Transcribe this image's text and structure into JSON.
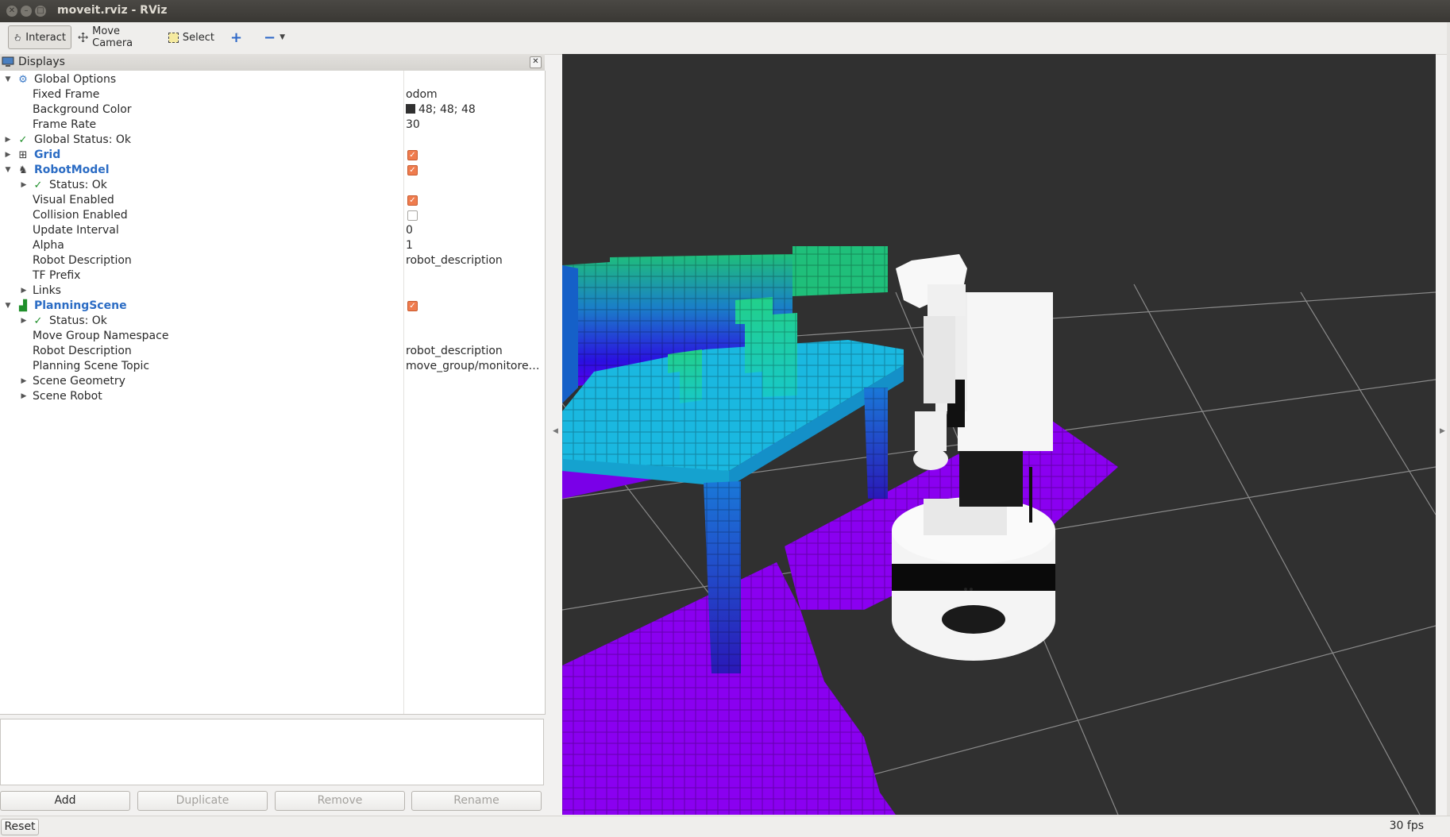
{
  "window": {
    "title": "moveit.rviz - RViz"
  },
  "toolbar": {
    "interact": "Interact",
    "move_camera": "Move Camera",
    "select": "Select",
    "add_tool_icon": "plus-icon",
    "remove_tool_icon": "minus-icon"
  },
  "displays_panel": {
    "title": "Displays",
    "rows": [
      {
        "label": "Global Options"
      },
      {
        "label": "Fixed Frame",
        "value": "odom"
      },
      {
        "label": "Background Color",
        "value": "48; 48; 48",
        "swatch": "#303030"
      },
      {
        "label": "Frame Rate",
        "value": "30"
      },
      {
        "label": "Global Status: Ok"
      },
      {
        "label": "Grid",
        "checked": true
      },
      {
        "label": "RobotModel",
        "checked": true
      },
      {
        "label": "Status: Ok"
      },
      {
        "label": "Visual Enabled",
        "checked": true
      },
      {
        "label": "Collision Enabled",
        "checked": false
      },
      {
        "label": "Update Interval",
        "value": "0"
      },
      {
        "label": "Alpha",
        "value": "1"
      },
      {
        "label": "Robot Description",
        "value": "robot_description"
      },
      {
        "label": "TF Prefix"
      },
      {
        "label": "Links"
      },
      {
        "label": "PlanningScene",
        "checked": true
      },
      {
        "label": "Status: Ok"
      },
      {
        "label": "Move Group Namespace"
      },
      {
        "label": "Robot Description",
        "value": "robot_description"
      },
      {
        "label": "Planning Scene Topic",
        "value": "move_group/monitore…"
      },
      {
        "label": "Scene Geometry"
      },
      {
        "label": "Scene Robot"
      }
    ]
  },
  "buttons": {
    "add": "Add",
    "duplicate": "Duplicate",
    "remove": "Remove",
    "rename": "Rename"
  },
  "status": {
    "reset": "Reset",
    "fps": "30 fps"
  },
  "colors": {
    "background": "#303030",
    "checkbox_on": "#ef7c4e",
    "link": "#2b6cc4"
  }
}
